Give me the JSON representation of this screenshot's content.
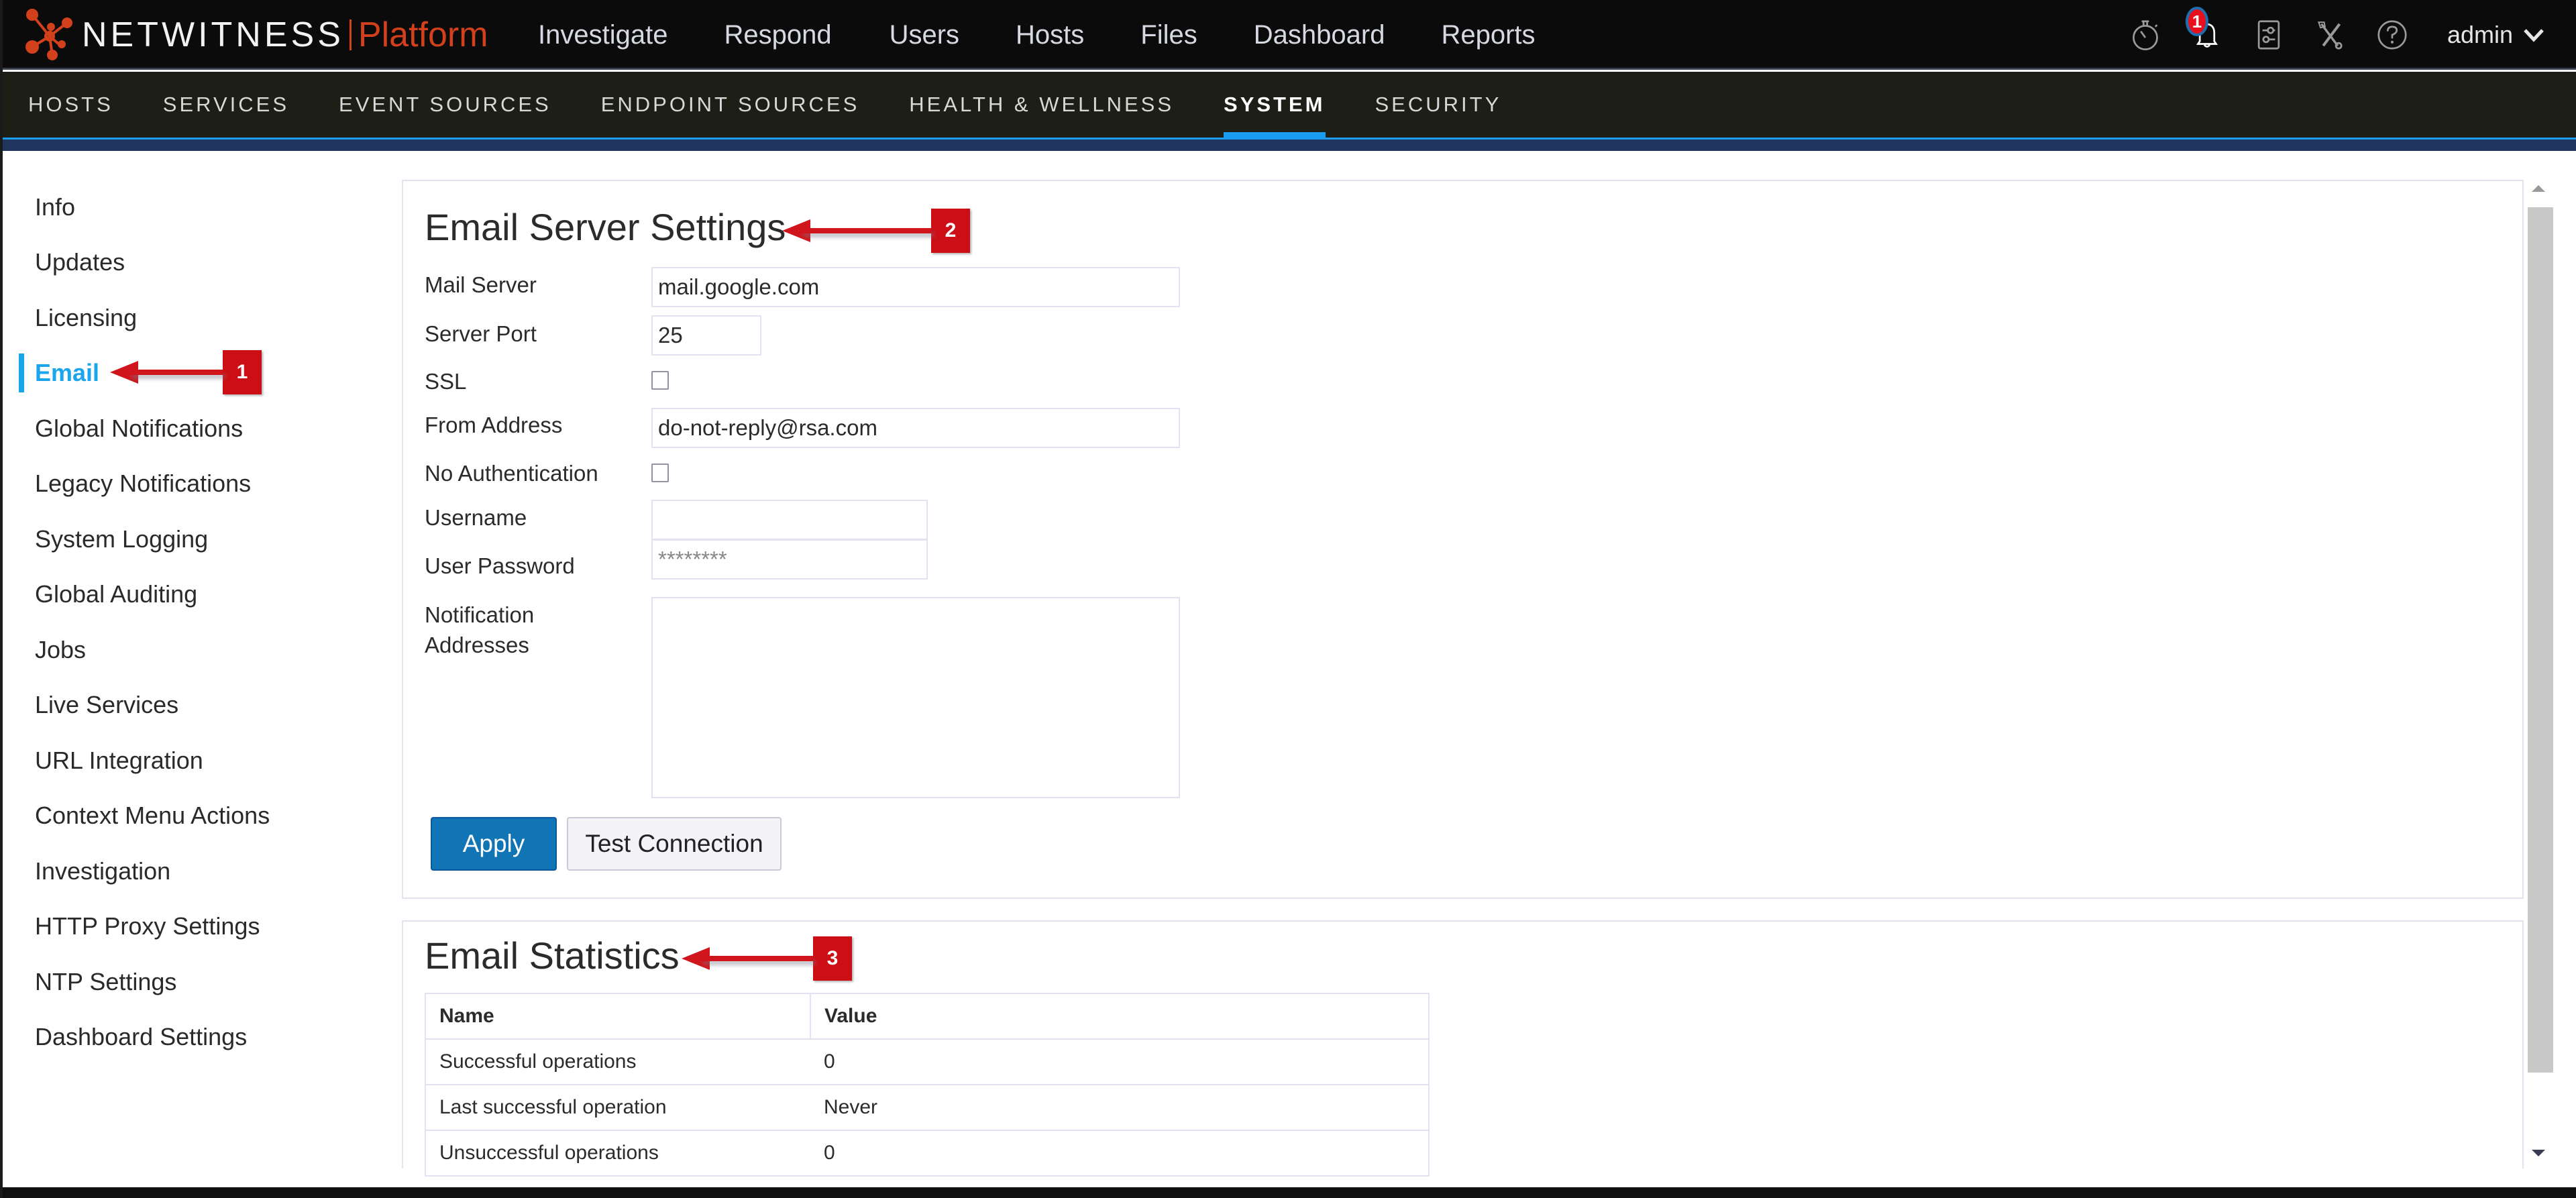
{
  "brand": {
    "name": "NETWITNESS",
    "product": "Platform",
    "accent_color": "#d2401c"
  },
  "main_nav": [
    {
      "label": "Investigate"
    },
    {
      "label": "Respond"
    },
    {
      "label": "Users"
    },
    {
      "label": "Hosts"
    },
    {
      "label": "Files"
    },
    {
      "label": "Dashboard"
    },
    {
      "label": "Reports"
    }
  ],
  "toolbar": {
    "icons": [
      "stopwatch-icon",
      "bell-icon",
      "settings-panel-icon",
      "tools-icon",
      "help-icon"
    ],
    "notification_count": "1",
    "user": "admin"
  },
  "sub_nav": {
    "tabs": [
      {
        "label": "HOSTS"
      },
      {
        "label": "SERVICES"
      },
      {
        "label": "EVENT SOURCES"
      },
      {
        "label": "ENDPOINT SOURCES"
      },
      {
        "label": "HEALTH & WELLNESS"
      },
      {
        "label": "SYSTEM",
        "active": true
      },
      {
        "label": "SECURITY"
      }
    ],
    "active_color": "#1a9cf0"
  },
  "sidebar": {
    "active_index": 3,
    "items": [
      {
        "label": "Info"
      },
      {
        "label": "Updates"
      },
      {
        "label": "Licensing"
      },
      {
        "label": "Email"
      },
      {
        "label": "Global Notifications"
      },
      {
        "label": "Legacy Notifications"
      },
      {
        "label": "System Logging"
      },
      {
        "label": "Global Auditing"
      },
      {
        "label": "Jobs"
      },
      {
        "label": "Live Services"
      },
      {
        "label": "URL Integration"
      },
      {
        "label": "Context Menu Actions"
      },
      {
        "label": "Investigation"
      },
      {
        "label": "HTTP Proxy Settings"
      },
      {
        "label": "NTP Settings"
      },
      {
        "label": "Dashboard Settings"
      }
    ]
  },
  "email_settings": {
    "title": "Email Server Settings",
    "fields": {
      "mail_server": {
        "label": "Mail Server",
        "value": "mail.google.com"
      },
      "server_port": {
        "label": "Server Port",
        "value": "25"
      },
      "ssl": {
        "label": "SSL",
        "checked": false
      },
      "from_address": {
        "label": "From Address",
        "value": "do-not-reply@rsa.com"
      },
      "no_auth": {
        "label": "No Authentication",
        "checked": false
      },
      "username": {
        "label": "Username",
        "value": ""
      },
      "password": {
        "label": "User Password",
        "value": "********"
      },
      "notification_addresses": {
        "label_line1": "Notification",
        "label_line2": "Addresses",
        "value": ""
      }
    },
    "buttons": {
      "apply": "Apply",
      "test_connection": "Test Connection"
    }
  },
  "email_statistics": {
    "title": "Email Statistics",
    "columns": [
      "Name",
      "Value"
    ],
    "rows": [
      {
        "name": "Successful operations",
        "value": "0"
      },
      {
        "name": "Last successful operation",
        "value": "Never"
      },
      {
        "name": "Unsuccessful operations",
        "value": "0"
      }
    ]
  },
  "annotations": [
    "1",
    "2",
    "3"
  ]
}
